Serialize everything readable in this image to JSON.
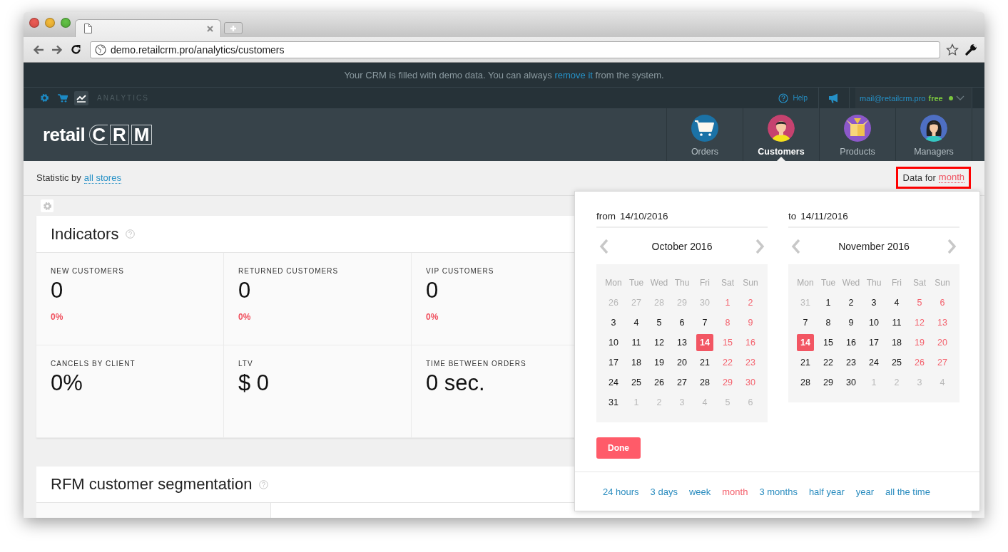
{
  "browser": {
    "url": "demo.retailcrm.pro/analytics/customers"
  },
  "banner": {
    "text_before": "Your CRM is filled with demo data. You can always ",
    "link": "remove it",
    "text_after": " from the system."
  },
  "topbar": {
    "apps": [
      {
        "kind": "settings",
        "selected": false
      },
      {
        "kind": "cart",
        "selected": false
      },
      {
        "kind": "analytics",
        "selected": true
      }
    ],
    "section": "ANALYTICS",
    "help": "Help",
    "email": "mail@retailcrm.pro",
    "plan": "free",
    "online": true
  },
  "header": {
    "logo": {
      "word": "retail",
      "letters": [
        "C",
        "R",
        "M"
      ]
    },
    "nav": [
      {
        "label": "Orders",
        "kind": "cart",
        "selected": false
      },
      {
        "label": "Customers",
        "kind": "customer",
        "selected": true
      },
      {
        "label": "Products",
        "kind": "box",
        "selected": false
      },
      {
        "label": "Managers",
        "kind": "manager",
        "selected": false
      }
    ]
  },
  "filters": {
    "prefix": "Statistic by",
    "store": "all stores",
    "period_label": "Data for",
    "period": "month",
    "highlighted": true
  },
  "indicators": {
    "title": "Indicators",
    "cells": [
      {
        "label": "NEW CUSTOMERS",
        "value": "0",
        "change": "0%"
      },
      {
        "label": "RETURNED CUSTOMERS",
        "value": "0",
        "change": "0%"
      },
      {
        "label": "VIP CUSTOMERS",
        "value": "0",
        "change": "0%"
      },
      {
        "label": "CANCELS BY CLIENT",
        "value": "0%"
      },
      {
        "label": "LTV",
        "value": "$ 0"
      },
      {
        "label": "TIME BETWEEN ORDERS",
        "value": "0 sec."
      }
    ]
  },
  "rfm": {
    "title": "RFM customer segmentation"
  },
  "datepicker": {
    "months": [
      {
        "prefix": "from",
        "date": "14/10/2016",
        "month": "October 2016",
        "weekdays": [
          "Mon",
          "Tue",
          "Wed",
          "Thu",
          "Fri",
          "Sat",
          "Sun"
        ],
        "weeks": [
          [
            {
              "t": "26",
              "kind": "other",
              "selected": false
            },
            {
              "t": "27",
              "kind": "other",
              "selected": false
            },
            {
              "t": "28",
              "kind": "other",
              "selected": false
            },
            {
              "t": "29",
              "kind": "other",
              "selected": false
            },
            {
              "t": "30",
              "kind": "other",
              "selected": false
            },
            {
              "t": "1",
              "kind": "weekend",
              "selected": false
            },
            {
              "t": "2",
              "kind": "weekend",
              "selected": false
            }
          ],
          [
            {
              "t": "3",
              "kind": "day",
              "selected": false
            },
            {
              "t": "4",
              "kind": "day",
              "selected": false
            },
            {
              "t": "5",
              "kind": "day",
              "selected": false
            },
            {
              "t": "6",
              "kind": "day",
              "selected": false
            },
            {
              "t": "7",
              "kind": "day",
              "selected": false
            },
            {
              "t": "8",
              "kind": "weekend",
              "selected": false
            },
            {
              "t": "9",
              "kind": "weekend",
              "selected": false
            }
          ],
          [
            {
              "t": "10",
              "kind": "day",
              "selected": false
            },
            {
              "t": "11",
              "kind": "day",
              "selected": false
            },
            {
              "t": "12",
              "kind": "day",
              "selected": false
            },
            {
              "t": "13",
              "kind": "day",
              "selected": false
            },
            {
              "t": "14",
              "kind": "day",
              "selected": true
            },
            {
              "t": "15",
              "kind": "weekend",
              "selected": false
            },
            {
              "t": "16",
              "kind": "weekend",
              "selected": false
            }
          ],
          [
            {
              "t": "17",
              "kind": "day",
              "selected": false
            },
            {
              "t": "18",
              "kind": "day",
              "selected": false
            },
            {
              "t": "19",
              "kind": "day",
              "selected": false
            },
            {
              "t": "20",
              "kind": "day",
              "selected": false
            },
            {
              "t": "21",
              "kind": "day",
              "selected": false
            },
            {
              "t": "22",
              "kind": "weekend",
              "selected": false
            },
            {
              "t": "23",
              "kind": "weekend",
              "selected": false
            }
          ],
          [
            {
              "t": "24",
              "kind": "day",
              "selected": false
            },
            {
              "t": "25",
              "kind": "day",
              "selected": false
            },
            {
              "t": "26",
              "kind": "day",
              "selected": false
            },
            {
              "t": "27",
              "kind": "day",
              "selected": false
            },
            {
              "t": "28",
              "kind": "day",
              "selected": false
            },
            {
              "t": "29",
              "kind": "weekend",
              "selected": false
            },
            {
              "t": "30",
              "kind": "weekend",
              "selected": false
            }
          ],
          [
            {
              "t": "31",
              "kind": "day",
              "selected": false
            },
            {
              "t": "1",
              "kind": "other",
              "selected": false
            },
            {
              "t": "2",
              "kind": "other",
              "selected": false
            },
            {
              "t": "3",
              "kind": "other",
              "selected": false
            },
            {
              "t": "4",
              "kind": "other",
              "selected": false
            },
            {
              "t": "5",
              "kind": "other",
              "selected": false
            },
            {
              "t": "6",
              "kind": "other",
              "selected": false
            }
          ]
        ]
      },
      {
        "prefix": "to",
        "date": "14/11/2016",
        "month": "November 2016",
        "weekdays": [
          "Mon",
          "Tue",
          "Wed",
          "Thu",
          "Fri",
          "Sat",
          "Sun"
        ],
        "weeks": [
          [
            {
              "t": "31",
              "kind": "other",
              "selected": false
            },
            {
              "t": "1",
              "kind": "day",
              "selected": false
            },
            {
              "t": "2",
              "kind": "day",
              "selected": false
            },
            {
              "t": "3",
              "kind": "day",
              "selected": false
            },
            {
              "t": "4",
              "kind": "day",
              "selected": false
            },
            {
              "t": "5",
              "kind": "weekend",
              "selected": false
            },
            {
              "t": "6",
              "kind": "weekend",
              "selected": false
            }
          ],
          [
            {
              "t": "7",
              "kind": "day",
              "selected": false
            },
            {
              "t": "8",
              "kind": "day",
              "selected": false
            },
            {
              "t": "9",
              "kind": "day",
              "selected": false
            },
            {
              "t": "10",
              "kind": "day",
              "selected": false
            },
            {
              "t": "11",
              "kind": "day",
              "selected": false
            },
            {
              "t": "12",
              "kind": "weekend",
              "selected": false
            },
            {
              "t": "13",
              "kind": "weekend",
              "selected": false
            }
          ],
          [
            {
              "t": "14",
              "kind": "day",
              "selected": true
            },
            {
              "t": "15",
              "kind": "day",
              "selected": false
            },
            {
              "t": "16",
              "kind": "day",
              "selected": false
            },
            {
              "t": "17",
              "kind": "day",
              "selected": false
            },
            {
              "t": "18",
              "kind": "day",
              "selected": false
            },
            {
              "t": "19",
              "kind": "weekend",
              "selected": false
            },
            {
              "t": "20",
              "kind": "weekend",
              "selected": false
            }
          ],
          [
            {
              "t": "21",
              "kind": "day",
              "selected": false
            },
            {
              "t": "22",
              "kind": "day",
              "selected": false
            },
            {
              "t": "23",
              "kind": "day",
              "selected": false
            },
            {
              "t": "24",
              "kind": "day",
              "selected": false
            },
            {
              "t": "25",
              "kind": "day",
              "selected": false
            },
            {
              "t": "26",
              "kind": "weekend",
              "selected": false
            },
            {
              "t": "27",
              "kind": "weekend",
              "selected": false
            }
          ],
          [
            {
              "t": "28",
              "kind": "day",
              "selected": false
            },
            {
              "t": "29",
              "kind": "day",
              "selected": false
            },
            {
              "t": "30",
              "kind": "day",
              "selected": false
            },
            {
              "t": "1",
              "kind": "other",
              "selected": false
            },
            {
              "t": "2",
              "kind": "other",
              "selected": false
            },
            {
              "t": "3",
              "kind": "other",
              "selected": false
            },
            {
              "t": "4",
              "kind": "other",
              "selected": false
            }
          ]
        ]
      }
    ],
    "done": "Done",
    "presets": [
      {
        "label": "24 hours",
        "selected": false
      },
      {
        "label": "3 days",
        "selected": false
      },
      {
        "label": "week",
        "selected": false
      },
      {
        "label": "month",
        "selected": true
      },
      {
        "label": "3 months",
        "selected": false
      },
      {
        "label": "half year",
        "selected": false
      },
      {
        "label": "year",
        "selected": false
      },
      {
        "label": "all the time",
        "selected": false
      }
    ]
  }
}
